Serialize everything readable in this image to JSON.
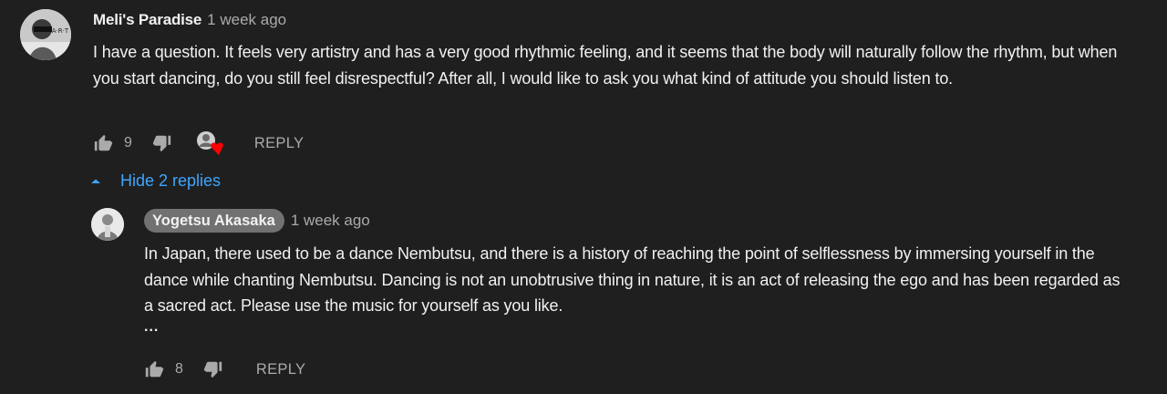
{
  "comment": {
    "author": "Meli's Paradise",
    "time": "1 week ago",
    "avatar_text": "A·R·T",
    "text": "I have a question. It feels very artistry and has a very good rhythmic feeling, and it seems that the body will naturally follow the rhythm, but when you start dancing, do you still feel disrespectful? After all, I would like to ask you what kind of attitude you should listen to.",
    "likes": "9",
    "reply_label": "REPLY",
    "hearted": true
  },
  "replies_toggle": {
    "label": "Hide 2 replies"
  },
  "reply": {
    "author": "Yogetsu Akasaka",
    "time": "1 week ago",
    "text": "In Japan, there used to be a dance Nembutsu, and there is a history of reaching the point of selflessness by immersing yourself in the dance while chanting Nembutsu. Dancing is not an unobtrusive thing in nature, it is an act of releasing the ego and has been regarded as a sacred act. Please use the music for yourself as you like.",
    "ellipsis": "...",
    "likes": "8",
    "reply_label": "REPLY"
  },
  "colors": {
    "background": "#1f1f1f",
    "text": "#f1f1f1",
    "secondary": "#aaaaaa",
    "link": "#3ea6ff",
    "heart": "#ff0000",
    "chip": "#717171"
  }
}
